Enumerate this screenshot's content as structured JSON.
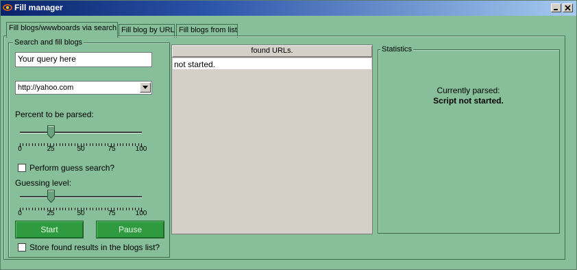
{
  "window": {
    "title": "Fill manager",
    "icon": "app-eye-icon",
    "controls": {
      "minimize": "minimize-icon",
      "close": "close-icon"
    }
  },
  "tabs": [
    {
      "label": "Fill blogs/wwwboards via search",
      "active": true
    },
    {
      "label": "Fill blog by URL",
      "active": false
    },
    {
      "label": "Fill blogs from list",
      "active": false
    }
  ],
  "search_group": {
    "legend": "Search and fill blogs",
    "query_value": "Your query here",
    "engine_selected": "http://yahoo.com",
    "percent_label": "Percent to be parsed:",
    "percent_value": 25,
    "tick_labels": [
      "0",
      "25",
      "50",
      "75",
      "100"
    ],
    "guess_checkbox_label": "Perform guess search?",
    "guess_checked": false,
    "guessing_label": "Guessing level:",
    "guessing_value": 25,
    "start_label": "Start",
    "pause_label": "Pause",
    "store_checkbox_label": "Store found results in the blogs list?",
    "store_checked": false
  },
  "found_urls": {
    "header": "found URLs.",
    "rows": [
      "not started."
    ]
  },
  "statistics": {
    "legend": "Statistics",
    "parsed_label": "Currently parsed:",
    "status_text": "Script not started."
  },
  "colors": {
    "window_bg": "#86bf9a",
    "button_green": "#2f9a3f",
    "title_gradient_start": "#0a246a"
  }
}
